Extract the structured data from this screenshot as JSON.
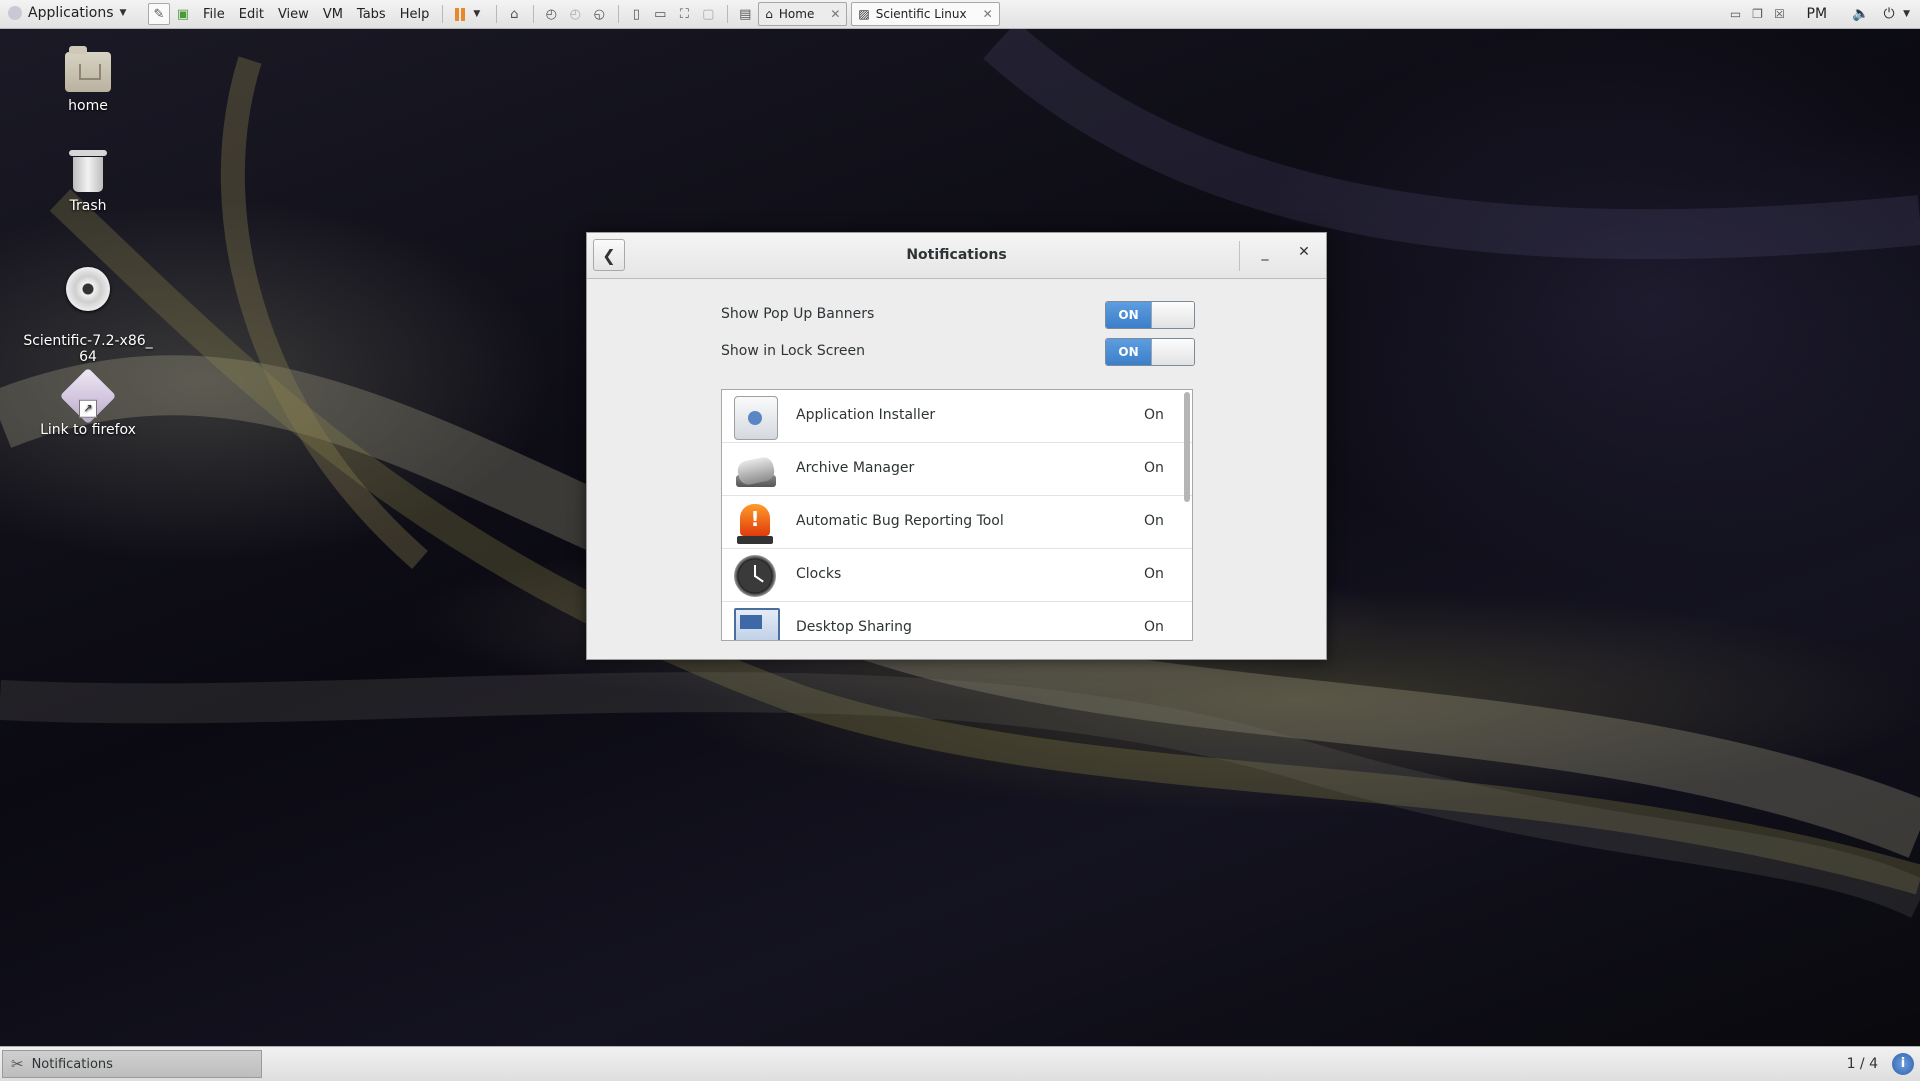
{
  "topbar": {
    "applications_label": "Applications",
    "menus": [
      "File",
      "Edit",
      "View",
      "VM",
      "Tabs",
      "Help"
    ],
    "tabs": [
      {
        "label": "Home",
        "active": false
      },
      {
        "label": "Scientific Linux",
        "active": true
      }
    ],
    "clock_partial": "PM"
  },
  "desktop": {
    "icons": [
      {
        "label": "home",
        "icon": "folder-home-icon"
      },
      {
        "label": "Trash",
        "icon": "trash-icon"
      },
      {
        "label": "Scientific-7.2-x86_\n64",
        "icon": "disc-icon"
      },
      {
        "label": "Link to firefox",
        "icon": "link-icon"
      }
    ]
  },
  "dialog": {
    "title": "Notifications",
    "switches": [
      {
        "label": "Show Pop Up Banners",
        "state": "ON"
      },
      {
        "label": "Show in Lock Screen",
        "state": "ON"
      }
    ],
    "apps": [
      {
        "name": "Application Installer",
        "state": "On",
        "icon": "application-installer-icon"
      },
      {
        "name": "Archive Manager",
        "state": "On",
        "icon": "archive-manager-icon"
      },
      {
        "name": "Automatic Bug Reporting Tool",
        "state": "On",
        "icon": "bug-reporting-icon"
      },
      {
        "name": "Clocks",
        "state": "On",
        "icon": "clocks-icon"
      },
      {
        "name": "Desktop Sharing",
        "state": "On",
        "icon": "desktop-sharing-icon"
      }
    ]
  },
  "bottombar": {
    "task_label": "Notifications",
    "workspace": "1 / 4",
    "info_glyph": "i"
  },
  "colors": {
    "toggle_on": "#3c7fc9",
    "pause": "#e6882c"
  }
}
